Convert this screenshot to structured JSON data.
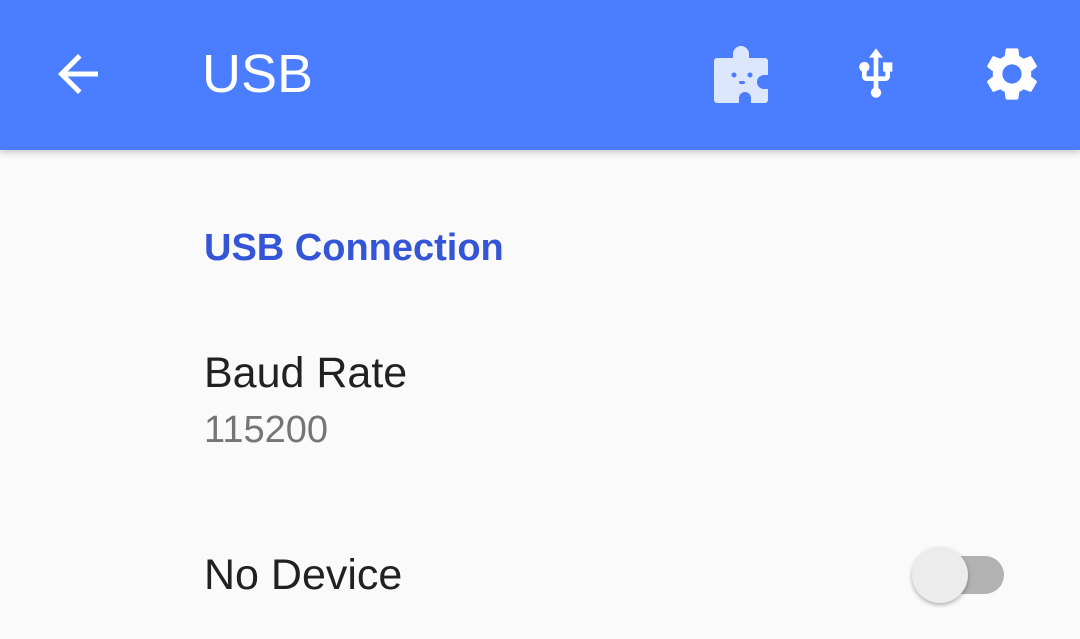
{
  "toolbar": {
    "title": "USB",
    "back_icon": "arrow-back-icon",
    "actions": [
      {
        "icon": "plugin-icon"
      },
      {
        "icon": "usb-icon"
      },
      {
        "icon": "gear-icon"
      }
    ]
  },
  "settings": {
    "category": "USB Connection",
    "baud_rate": {
      "title": "Baud Rate",
      "value": "115200"
    },
    "device": {
      "title": "No Device",
      "enabled": false
    }
  },
  "colors": {
    "toolbar": "#4a7dff",
    "accent": "#3355d6",
    "background": "#fafafa"
  }
}
